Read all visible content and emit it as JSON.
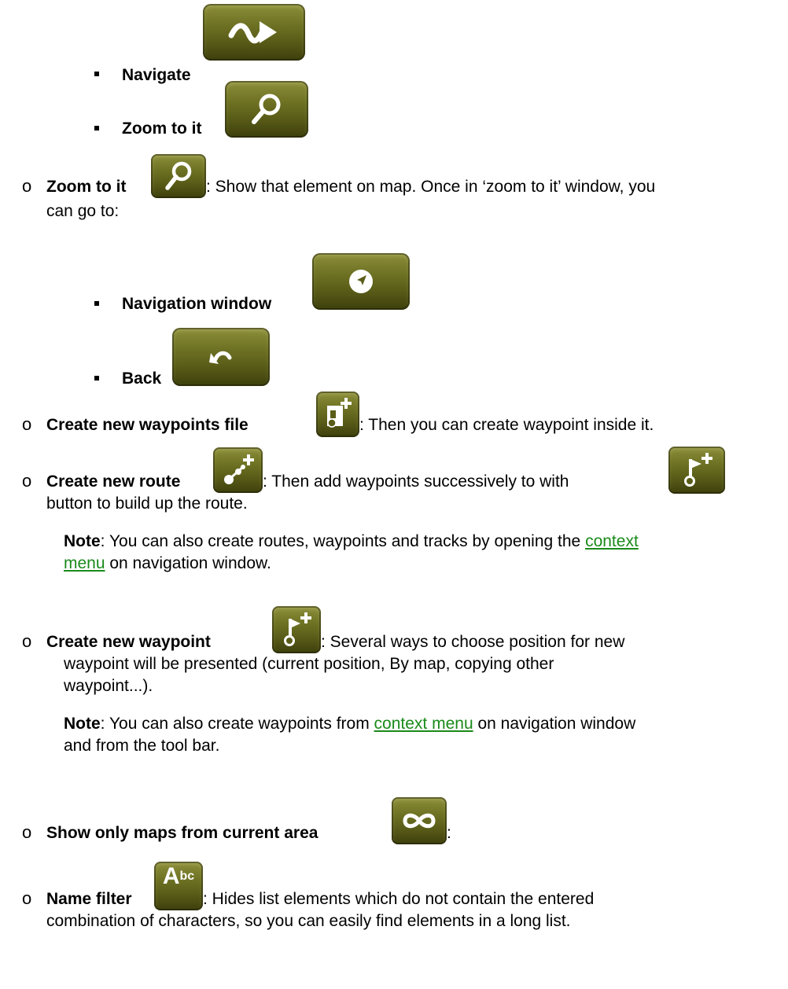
{
  "items": {
    "navigate": {
      "label": "Navigate",
      "icon": "navigate-arrow-icon"
    },
    "zoom_sub": {
      "label": "Zoom to it",
      "icon": "magnifier-icon"
    },
    "zoom_main": {
      "label": "Zoom to it",
      "icon": "magnifier-icon",
      "desc_line1": ": Show that element on map. Once in ‘zoom to it’ window, you",
      "desc_line2": "can go to:"
    },
    "navigation_window": {
      "label": "Navigation window",
      "icon": "compass-icon"
    },
    "back": {
      "label": "Back",
      "icon": "back-arrow-icon"
    },
    "new_wpt_file": {
      "label": "Create new waypoints file",
      "icon": "new-waypoints-file-icon",
      "desc": ": Then you can create waypoint inside it."
    },
    "new_route": {
      "label": "Create new route",
      "icon": "new-route-icon",
      "desc_a": ": Then add waypoints successively to with",
      "icon2": "new-waypoint-icon",
      "desc_line2": "button to build up the route."
    },
    "note1": {
      "label": "Note",
      "text_a": ": You can also create routes, waypoints and tracks by opening the",
      "link_a": "context",
      "link_b": "menu",
      "text_b": " on navigation window."
    },
    "new_waypoint": {
      "label": "Create new waypoint",
      "icon": "new-waypoint-icon",
      "desc_line1": ": Several ways to choose position for new",
      "desc_line2": "waypoint will be presented (current position, By map, copying other",
      "desc_line3": "waypoint...)."
    },
    "note2": {
      "label": "Note",
      "text_a": ": You can also create waypoints from ",
      "link": "context menu",
      "text_b": " on navigation window",
      "text_line2": "and from the tool bar."
    },
    "show_maps": {
      "label": "Show only maps from current area",
      "icon": "infinity-icon",
      "desc": ":"
    },
    "name_filter": {
      "label": "Name filter",
      "icon": "abc-icon",
      "icon_text_big": "A",
      "icon_text_small": "bc",
      "desc_line1": ": Hides list elements which do not contain the entered",
      "desc_line2": "combination of characters, so you can easily find elements in a long list."
    }
  },
  "colors": {
    "olive_dark": "#3d3f0c",
    "olive_light": "#8d8f3a",
    "link_green": "#1a8a1a"
  }
}
